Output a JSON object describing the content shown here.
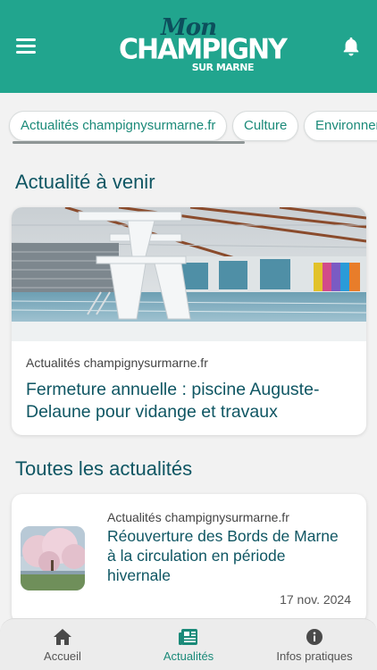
{
  "header": {
    "logo": {
      "line1": "Mon",
      "line2": "CHAMPIGNY",
      "line3": "SUR MARNE"
    },
    "menu_icon": "hamburger-menu-icon",
    "bell_icon": "bell-icon",
    "colors": {
      "header_bg": "#21a58e",
      "accent": "#0f5663",
      "accent_green": "#1b8a79"
    }
  },
  "chips": [
    {
      "label": "Actualités champignysurmarne.fr"
    },
    {
      "label": "Culture"
    },
    {
      "label": "Environnement"
    }
  ],
  "upcoming": {
    "section_title": "Actualité à venir",
    "card": {
      "source": "Actualités champignysurmarne.fr",
      "title": "Fermeture annuelle : piscine Auguste-Delaune pour vidange et travaux"
    }
  },
  "all_news": {
    "section_title": "Toutes les actualités",
    "items": [
      {
        "source": "Actualités champignysurmarne.fr",
        "title": "Réouverture des Bords de Marne à la circulation en période hivernale",
        "date": "17 nov. 2024"
      }
    ]
  },
  "tabbar": {
    "tabs": [
      {
        "label": "Accueil",
        "icon": "home-icon",
        "active": false
      },
      {
        "label": "Actualités",
        "icon": "newspaper-icon",
        "active": true
      },
      {
        "label": "Infos pratiques",
        "icon": "info-icon",
        "active": false
      }
    ]
  }
}
